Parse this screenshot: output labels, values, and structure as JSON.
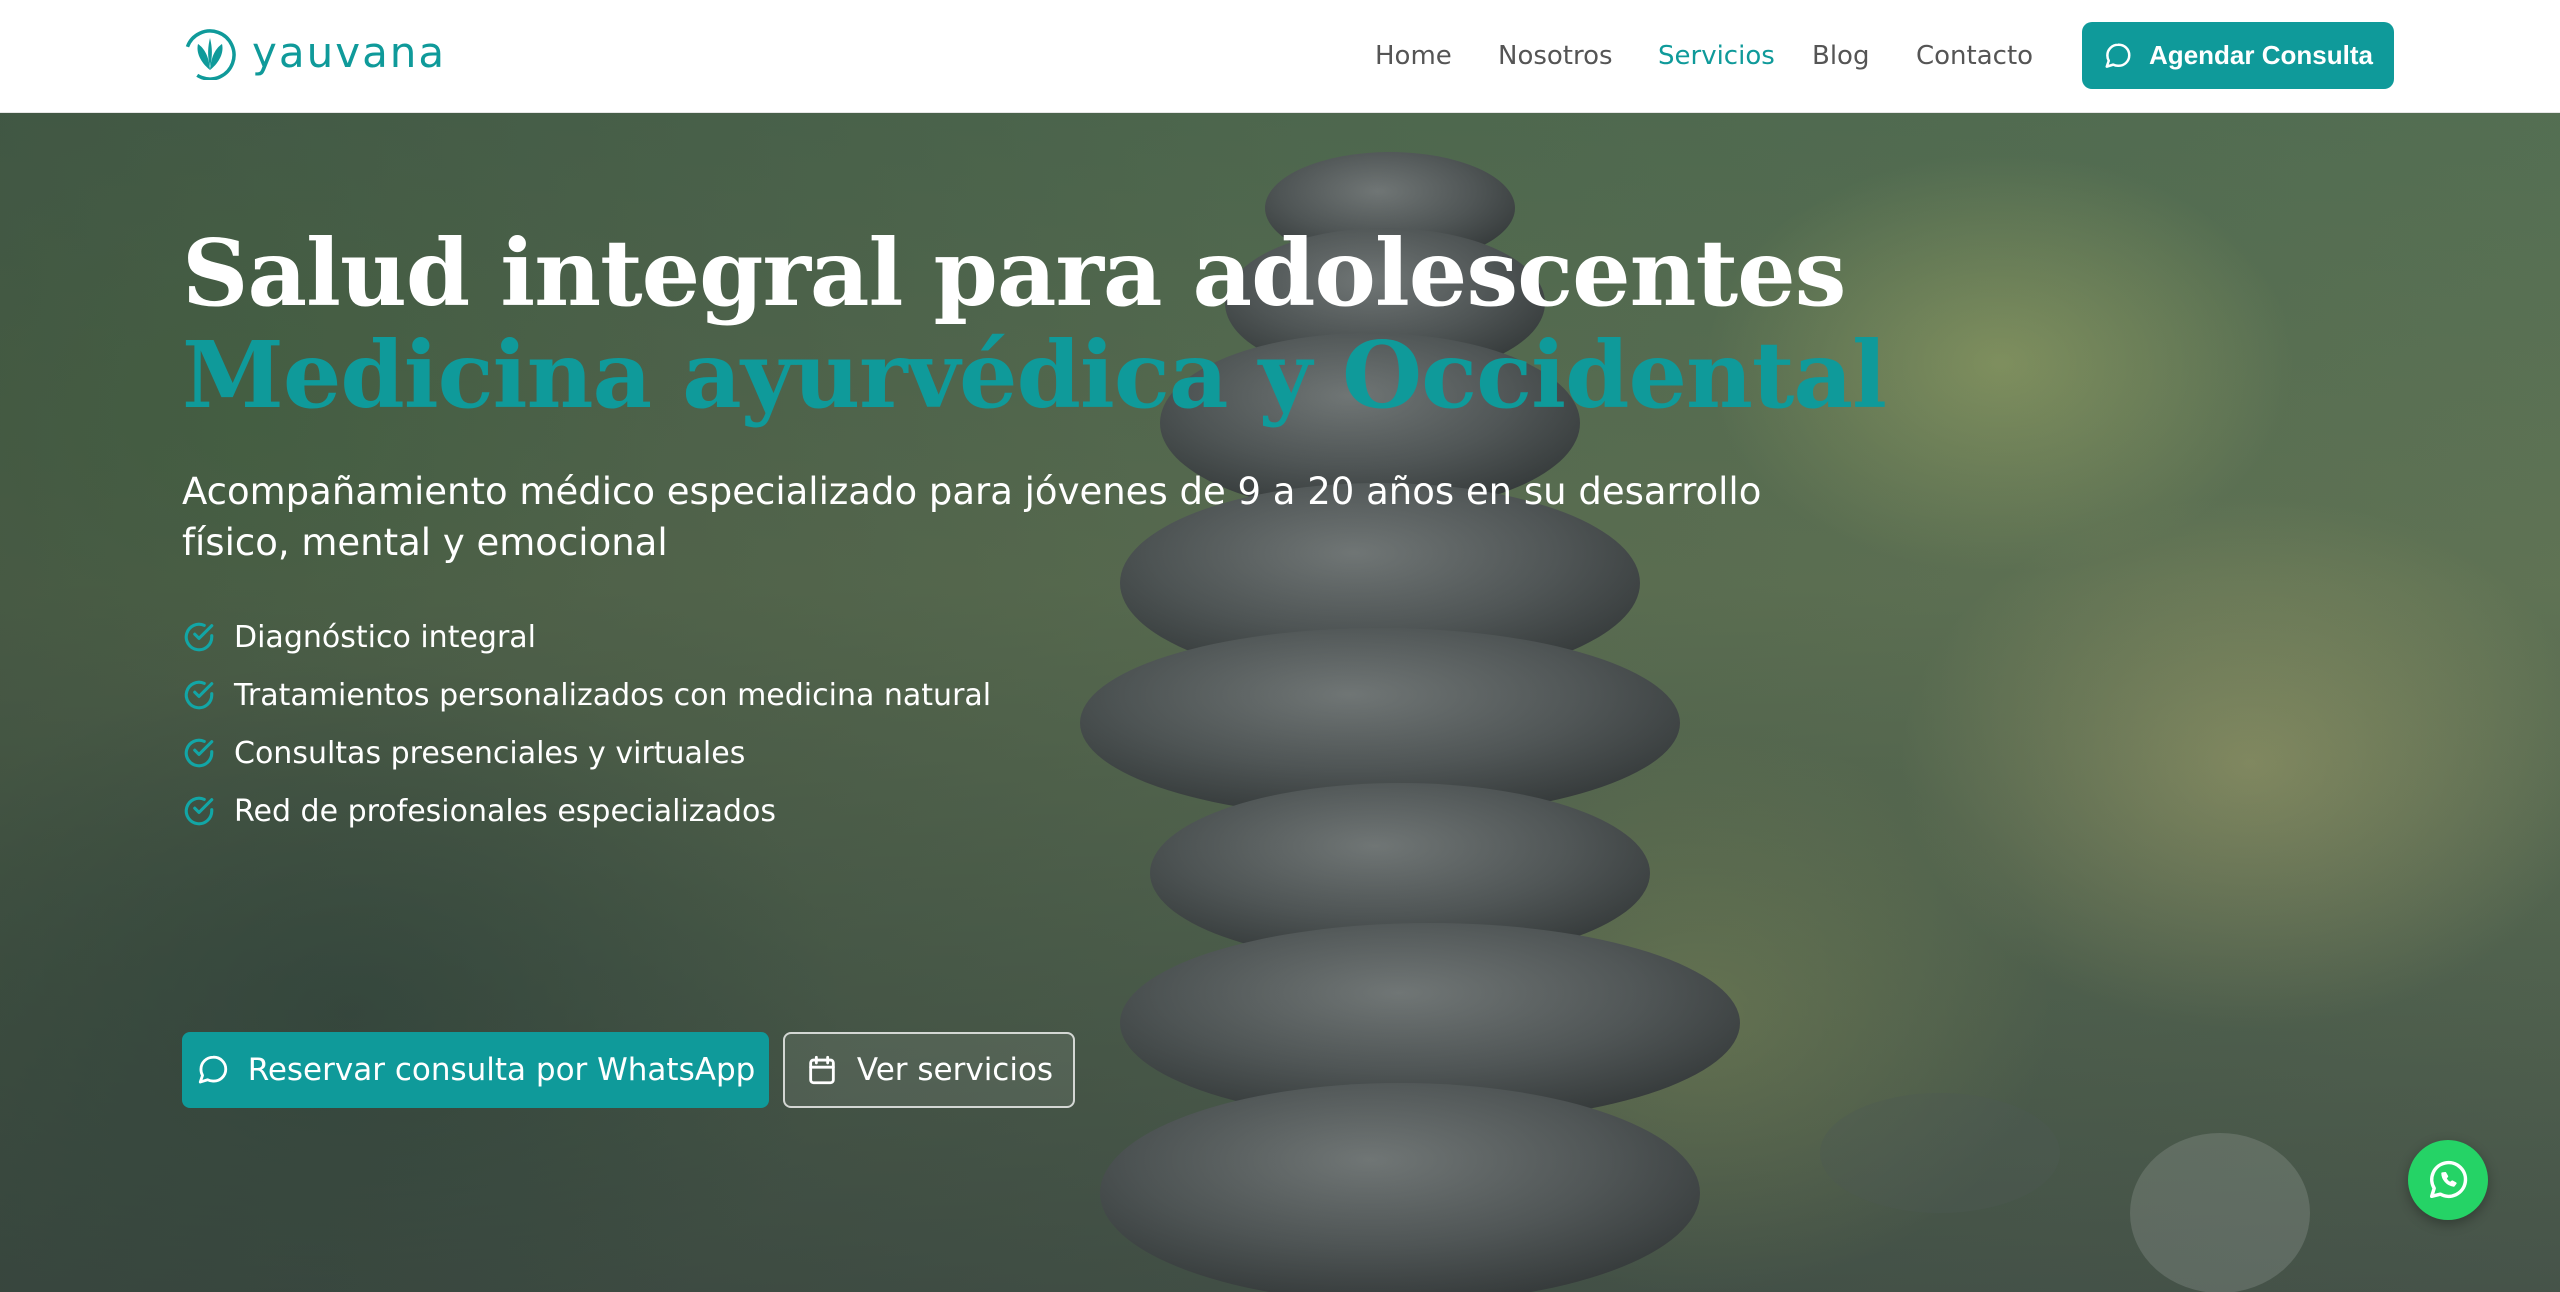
{
  "brand": {
    "name": "yauvana",
    "color": "#0f9a9a"
  },
  "nav": {
    "items": [
      {
        "label": "Home",
        "active": false
      },
      {
        "label": "Nosotros",
        "active": false
      },
      {
        "label": "Servicios",
        "active": true
      },
      {
        "label": "Blog",
        "active": false
      },
      {
        "label": "Contacto",
        "active": false
      }
    ],
    "cta_label": "Agendar Consulta",
    "cta_icon": "chat-bubble-icon"
  },
  "hero": {
    "title_line1": "Salud integral para adolescentes",
    "title_line2": "Medicina ayurvédica y Occidental",
    "subtitle": "Acompañamiento médico especializado para jóvenes de 9 a 20 años en su desarrollo físico, mental y emocional",
    "features": [
      "Diagnóstico integral",
      "Tratamientos personalizados con medicina natural",
      "Consultas presenciales y virtuales",
      "Red de profesionales especializados"
    ],
    "feature_icon": "check-circle-icon",
    "primary_button": {
      "label": "Reservar consulta por WhatsApp",
      "icon": "chat-bubble-icon"
    },
    "secondary_button": {
      "label": "Ver servicios",
      "icon": "calendar-icon"
    }
  },
  "floating_whatsapp": {
    "icon": "whatsapp-icon",
    "color": "#25d366"
  }
}
